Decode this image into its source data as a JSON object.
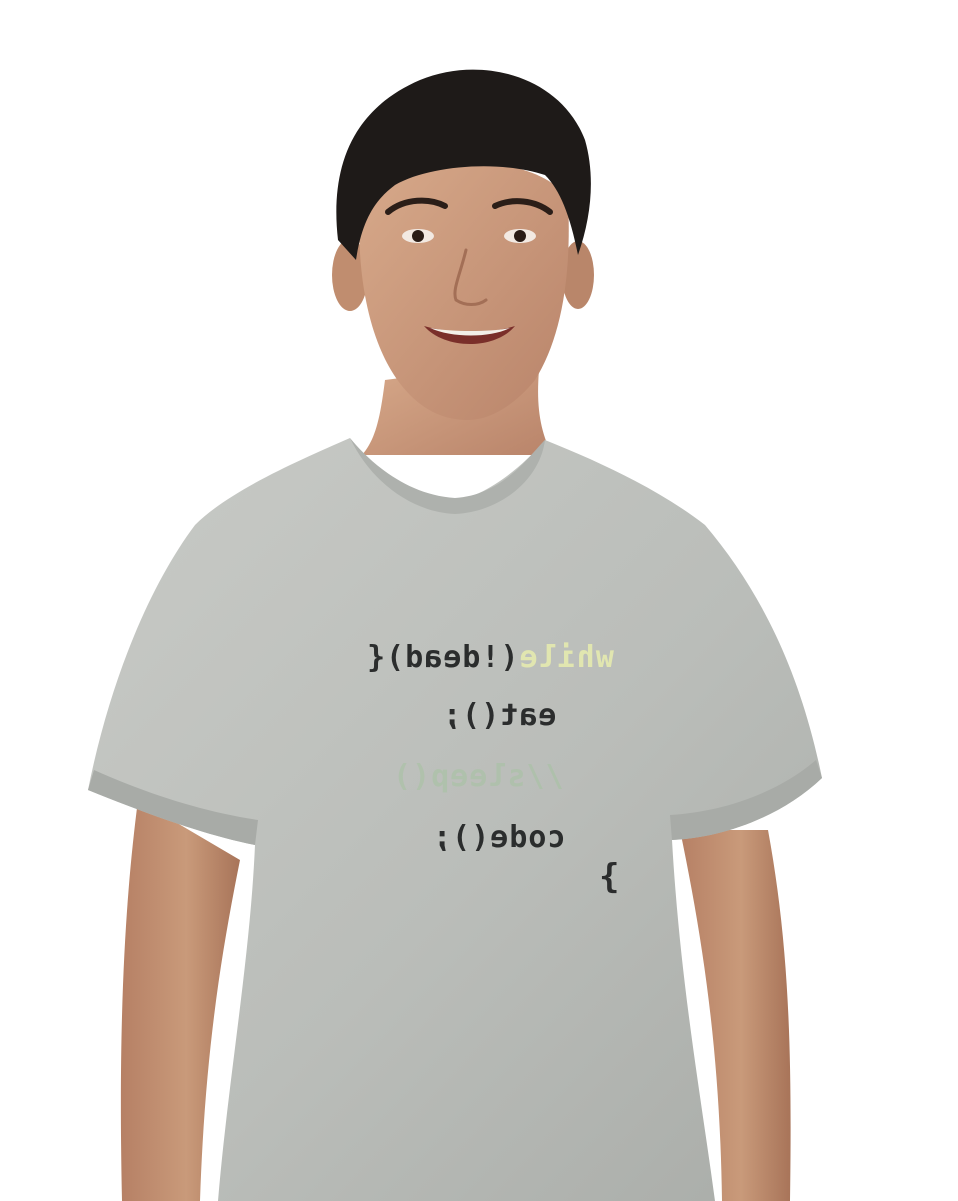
{
  "photo": {
    "subject": "person",
    "background_color": "#ffffff",
    "shirt_color": "#b9bcb8",
    "skin_color": "#c99a7a",
    "hair_color": "#1e1a18"
  },
  "shirt_print": {
    "line1_keyword": "while",
    "line1_rest": "(!dead){",
    "line2": "eat();",
    "line3": "//sleep()",
    "line4": "code();",
    "line5": "}",
    "colors": {
      "ink": "#2b2d2d",
      "keyword": "#e1e6b0",
      "comment": "#a6c3a1"
    }
  }
}
